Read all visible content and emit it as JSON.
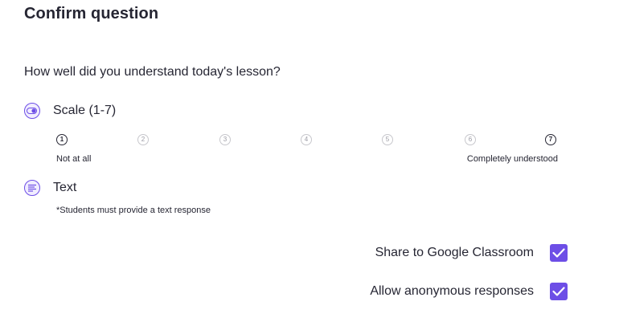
{
  "title": "Confirm question",
  "question": "How well did you understand today's lesson?",
  "response_types": {
    "scale": {
      "label": "Scale (1-7)",
      "icon": "scale-toggle-icon",
      "points": [
        "1",
        "2",
        "3",
        "4",
        "5",
        "6",
        "7"
      ],
      "low_label": "Not at all",
      "high_label": "Completely understood"
    },
    "text": {
      "label": "Text",
      "icon": "text-lines-icon",
      "note": "*Students must provide a text response"
    }
  },
  "options": {
    "share_google_classroom": {
      "label": "Share to Google Classroom",
      "checked": true
    },
    "allow_anonymous": {
      "label": "Allow anonymous responses",
      "checked": true
    }
  },
  "colors": {
    "accent": "#6d4ee6",
    "text": "#262633",
    "muted": "#9a9aa3"
  }
}
